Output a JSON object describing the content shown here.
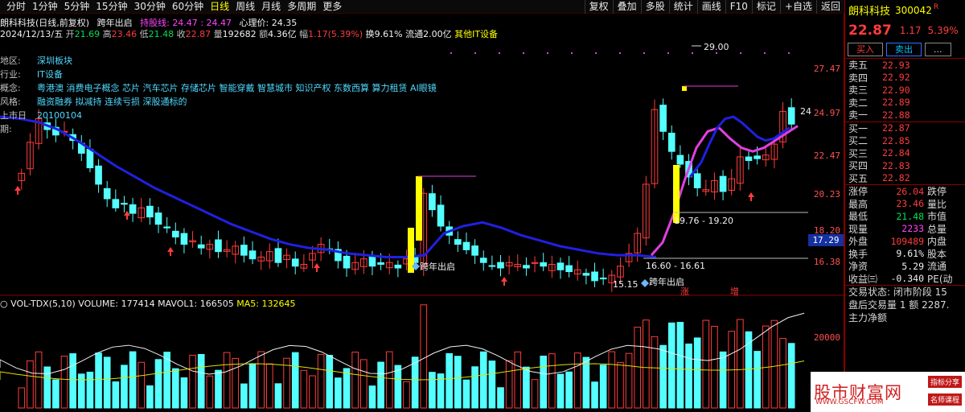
{
  "toolbar": {
    "periods": [
      "分时",
      "1分钟",
      "5分钟",
      "15分钟",
      "30分钟",
      "60分钟",
      "日线",
      "周线",
      "月线",
      "多周期",
      "更多"
    ],
    "active_period": "日线",
    "tools": [
      "复权",
      "叠加",
      "多股",
      "统计",
      "画线",
      "F10",
      "标记",
      "+自选",
      "返回"
    ]
  },
  "header": {
    "title": "朗科科技(日线,前复权)",
    "indicator": "跨年出启",
    "line_label": "持股线:",
    "line_v1": "24.47",
    "line_v2": "24.47",
    "psych_label": "心理价:",
    "psych_value": "24.35"
  },
  "ohlc": {
    "date": "2024/12/13/五",
    "open_label": "开",
    "open": "21.69",
    "high_label": "高",
    "high": "23.46",
    "low_label": "低",
    "low": "21.48",
    "close_label": "收",
    "close": "22.87",
    "vol_label": "量",
    "vol": "192682",
    "amt_label": "额",
    "amt": "4.36亿",
    "range_label": "幅",
    "range": "1.17(5.39%)",
    "turnover": "换9.61%",
    "float": "流通2.00亿",
    "sector": "其他IT设备"
  },
  "f10": [
    {
      "k": "地区:",
      "v": "深圳板块"
    },
    {
      "k": "行业:",
      "v": "IT设备"
    },
    {
      "k": "概念:",
      "v": "粤港澳 消费电子概念 芯片 汽车芯片 存储芯片 智能穿戴 智慧城市 知识产权 东数西算 算力租赁 AI眼镜"
    },
    {
      "k": "风格:",
      "v": "融资融券 拟减持 连续亏损 深股通标的"
    },
    {
      "k": "上市日期:",
      "v": "20100104"
    }
  ],
  "price_axis": [
    "27.47",
    "24.97",
    "22.47",
    "20.23",
    "18.20",
    "16.38"
  ],
  "price_axis_current": "17.29",
  "annotations": {
    "peak": "29.00",
    "band1": "19.76 - 19.20",
    "band2": "16.60 - 16.61",
    "low": "15.15",
    "signal1": "跨年出启",
    "signal2": "跨年出启",
    "marker_zhang": "涨",
    "marker_zeng": "增",
    "cur_marker": "24"
  },
  "volume": {
    "title": "VOL-TDX(5,10)",
    "vol_label": "VOLUME:",
    "vol": "177414",
    "ma1_label": "MAVOL1:",
    "ma1": "166505",
    "ma5_label": "MA5:",
    "ma5": "132645",
    "axis": "20000"
  },
  "stock": {
    "name": "朗科科技",
    "code": "300042",
    "flag": "R",
    "price": "22.87",
    "change": "1.17",
    "pct": "5.39%"
  },
  "buttons": {
    "buy": "买入",
    "sell": "卖出",
    "more": "..."
  },
  "asks": [
    {
      "n": "卖五",
      "p": "22.93"
    },
    {
      "n": "卖四",
      "p": "22.92"
    },
    {
      "n": "卖三",
      "p": "22.90"
    },
    {
      "n": "卖二",
      "p": "22.89"
    },
    {
      "n": "卖一",
      "p": "22.88"
    }
  ],
  "bids": [
    {
      "n": "买一",
      "p": "22.87"
    },
    {
      "n": "买二",
      "p": "22.85"
    },
    {
      "n": "买三",
      "p": "22.84"
    },
    {
      "n": "买四",
      "p": "22.83"
    },
    {
      "n": "买五",
      "p": "22.82"
    }
  ],
  "stats": [
    {
      "n": "涨停",
      "v": "26.04",
      "c": "red",
      "n2": "跌停"
    },
    {
      "n": "最高",
      "v": "23.46",
      "c": "red",
      "n2": "量比"
    },
    {
      "n": "最低",
      "v": "21.48",
      "c": "green",
      "n2": "市值"
    },
    {
      "n": "现量",
      "v": "2233",
      "c": "mag",
      "n2": "总量"
    },
    {
      "n": "外盘",
      "v": "109489",
      "c": "red",
      "n2": "内盘"
    },
    {
      "n": "换手",
      "v": "9.61%",
      "c": "white",
      "n2": "股本"
    },
    {
      "n": "净资",
      "v": "5.29",
      "c": "white",
      "n2": "流通"
    },
    {
      "n": "收益㈢",
      "v": "-0.340",
      "c": "white",
      "n2": "PE(动"
    }
  ],
  "trade_status": [
    "交易状态: 闭市阶段 15",
    "盘后交易量 1 额 2287.",
    "主力净额"
  ],
  "watermark": {
    "title": "股市财富网",
    "url": "WWW.GSCFW.COM",
    "tag1": "指标分享",
    "tag2": "名师课程"
  },
  "colors": {
    "up": "#ff3c3c",
    "down": "#54ffff",
    "ma_blue": "#2020e0",
    "ma_pink": "#e040e0",
    "signal_yellow": "#ffff00"
  }
}
